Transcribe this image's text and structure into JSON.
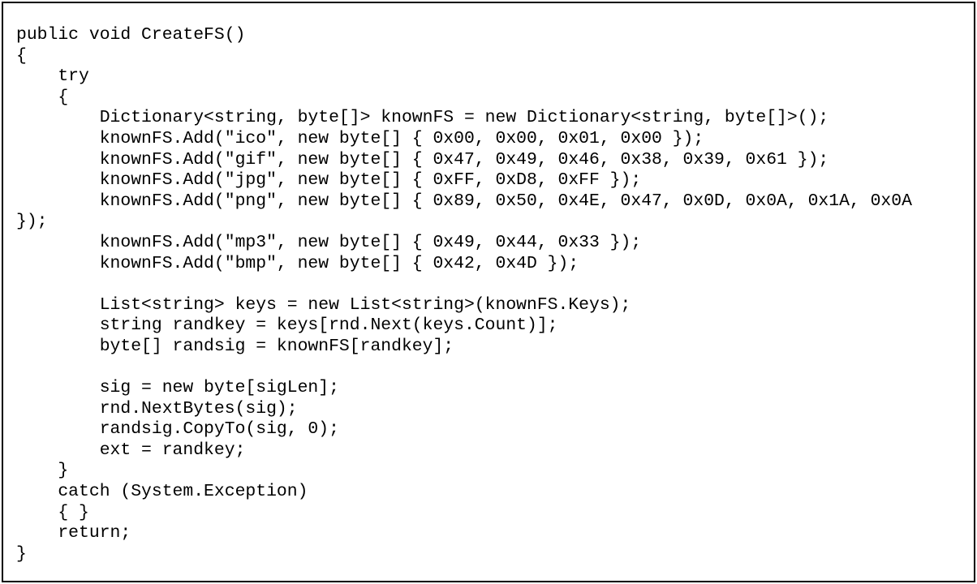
{
  "code": {
    "lines": [
      "public void CreateFS()",
      "{",
      "    try",
      "    {",
      "        Dictionary<string, byte[]> knownFS = new Dictionary<string, byte[]>();",
      "        knownFS.Add(\"ico\", new byte[] { 0x00, 0x00, 0x01, 0x00 });",
      "        knownFS.Add(\"gif\", new byte[] { 0x47, 0x49, 0x46, 0x38, 0x39, 0x61 });",
      "        knownFS.Add(\"jpg\", new byte[] { 0xFF, 0xD8, 0xFF });",
      "        knownFS.Add(\"png\", new byte[] { 0x89, 0x50, 0x4E, 0x47, 0x0D, 0x0A, 0x1A, 0x0A",
      "});",
      "        knownFS.Add(\"mp3\", new byte[] { 0x49, 0x44, 0x33 });",
      "        knownFS.Add(\"bmp\", new byte[] { 0x42, 0x4D });",
      "",
      "        List<string> keys = new List<string>(knownFS.Keys);",
      "        string randkey = keys[rnd.Next(keys.Count)];",
      "        byte[] randsig = knownFS[randkey];",
      "",
      "        sig = new byte[sigLen];",
      "        rnd.NextBytes(sig);",
      "        randsig.CopyTo(sig, 0);",
      "        ext = randkey;",
      "    }",
      "    catch (System.Exception)",
      "    { }",
      "    return;",
      "}"
    ]
  }
}
